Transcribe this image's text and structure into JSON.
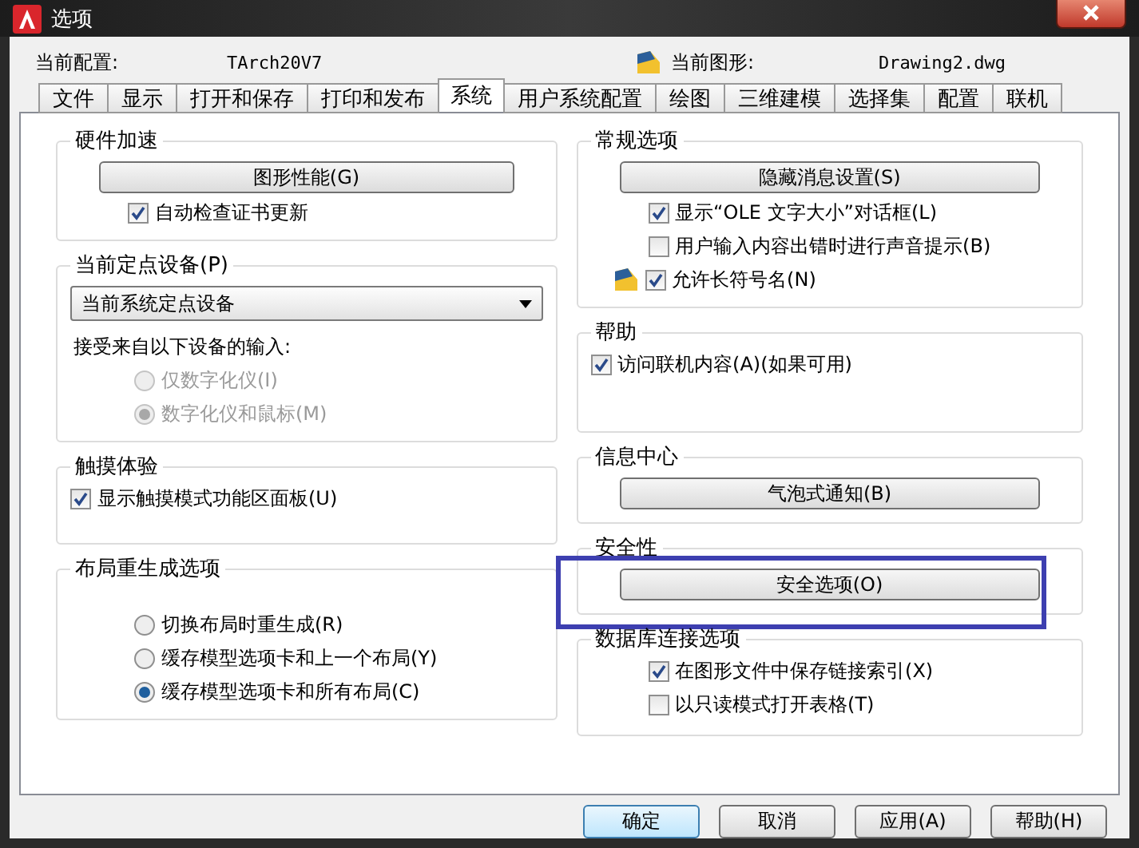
{
  "window": {
    "title": "选项"
  },
  "header": {
    "profile_label": "当前配置:",
    "profile_value": "TArch20V7",
    "drawing_label": "当前图形:",
    "drawing_value": "Drawing2.dwg"
  },
  "tabs": [
    {
      "label": "文件",
      "selected": false
    },
    {
      "label": "显示",
      "selected": false
    },
    {
      "label": "打开和保存",
      "selected": false
    },
    {
      "label": "打印和发布",
      "selected": false
    },
    {
      "label": "系统",
      "selected": true
    },
    {
      "label": "用户系统配置",
      "selected": false
    },
    {
      "label": "绘图",
      "selected": false
    },
    {
      "label": "三维建模",
      "selected": false
    },
    {
      "label": "选择集",
      "selected": false
    },
    {
      "label": "配置",
      "selected": false
    },
    {
      "label": "联机",
      "selected": false
    }
  ],
  "left_sections": [
    {
      "title": "硬件加速",
      "items": [
        {
          "kind": "button",
          "label": "图形性能(G)"
        },
        {
          "kind": "checkbox",
          "label": "自动检查证书更新",
          "checked": true
        }
      ]
    },
    {
      "title": "当前定点设备(P)",
      "items": [
        {
          "kind": "select",
          "value": "当前系统定点设备"
        },
        {
          "kind": "label",
          "label": "接受来自以下设备的输入:",
          "children": [
            {
              "kind": "radio",
              "label": "仅数字化仪(I)",
              "selected": false,
              "disabled": true
            },
            {
              "kind": "radio",
              "label": "数字化仪和鼠标(M)",
              "selected": true,
              "disabled": true
            }
          ]
        }
      ]
    },
    {
      "title": "触摸体验",
      "items": [
        {
          "kind": "checkbox",
          "label": "显示触摸模式功能区面板(U)",
          "checked": true
        }
      ]
    },
    {
      "title": "布局重生成选项",
      "items": [
        {
          "kind": "radio",
          "label": "切换布局时重生成(R)",
          "selected": false,
          "disabled": false
        },
        {
          "kind": "radio",
          "label": "缓存模型选项卡和上一个布局(Y)",
          "selected": false,
          "disabled": false
        },
        {
          "kind": "radio",
          "label": "缓存模型选项卡和所有布局(C)",
          "selected": true,
          "disabled": false
        }
      ]
    }
  ],
  "right_sections": [
    {
      "title": "常规选项",
      "items": [
        {
          "kind": "button",
          "label": "隐藏消息设置(S)"
        },
        {
          "kind": "checkbox",
          "label": "显示“OLE 文字大小”对话框(L)",
          "checked": true
        },
        {
          "kind": "checkbox",
          "label": "用户输入内容出错时进行声音提示(B)",
          "checked": false
        },
        {
          "kind": "checkbox",
          "label": "允许长符号名(N)",
          "checked": true,
          "has_icon": true
        }
      ]
    },
    {
      "title": "帮助",
      "items": [
        {
          "kind": "checkbox",
          "label": "访问联机内容(A)(如果可用)",
          "checked": true
        }
      ]
    },
    {
      "title": "信息中心",
      "items": [
        {
          "kind": "button",
          "label": "气泡式通知(B)"
        }
      ]
    },
    {
      "title": "安全性",
      "highlighted": true,
      "items": [
        {
          "kind": "button",
          "label": "安全选项(O)"
        }
      ]
    },
    {
      "title": "数据库连接选项",
      "items": [
        {
          "kind": "checkbox",
          "label": "在图形文件中保存链接索引(X)",
          "checked": true
        },
        {
          "kind": "checkbox",
          "label": "以只读模式打开表格(T)",
          "checked": false
        }
      ]
    }
  ],
  "buttons": [
    {
      "label": "确定",
      "default": true
    },
    {
      "label": "取消",
      "default": false
    },
    {
      "label": "应用(A)",
      "default": false
    },
    {
      "label": "帮助(H)",
      "default": false
    }
  ]
}
